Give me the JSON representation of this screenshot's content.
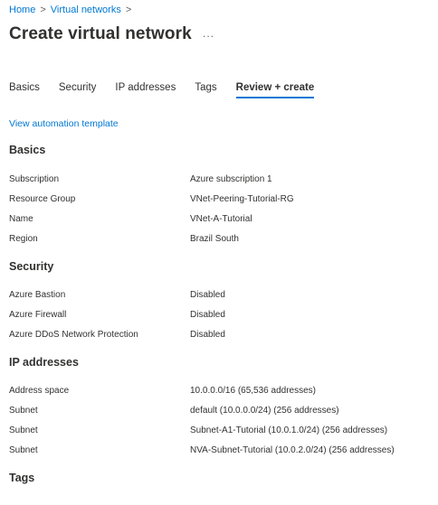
{
  "breadcrumb": {
    "items": [
      "Home",
      "Virtual networks"
    ],
    "separator": ">"
  },
  "page": {
    "title": "Create virtual network",
    "more_icon": "ellipsis-icon",
    "more_label": "..."
  },
  "tabs": [
    {
      "label": "Basics",
      "active": false
    },
    {
      "label": "Security",
      "active": false
    },
    {
      "label": "IP addresses",
      "active": false
    },
    {
      "label": "Tags",
      "active": false
    },
    {
      "label": "Review + create",
      "active": true
    }
  ],
  "automation_link": "View automation template",
  "sections": {
    "basics": {
      "heading": "Basics",
      "rows": [
        {
          "label": "Subscription",
          "value": "Azure subscription 1"
        },
        {
          "label": "Resource Group",
          "value": "VNet-Peering-Tutorial-RG"
        },
        {
          "label": "Name",
          "value": "VNet-A-Tutorial"
        },
        {
          "label": "Region",
          "value": "Brazil South"
        }
      ]
    },
    "security": {
      "heading": "Security",
      "rows": [
        {
          "label": "Azure Bastion",
          "value": "Disabled"
        },
        {
          "label": "Azure Firewall",
          "value": "Disabled"
        },
        {
          "label": "Azure DDoS Network Protection",
          "value": "Disabled"
        }
      ]
    },
    "ip_addresses": {
      "heading": "IP addresses",
      "rows": [
        {
          "label": "Address space",
          "value": "10.0.0.0/16 (65,536 addresses)"
        },
        {
          "label": "Subnet",
          "value": "default (10.0.0.0/24) (256 addresses)"
        },
        {
          "label": "Subnet",
          "value": "Subnet-A1-Tutorial (10.0.1.0/24) (256 addresses)"
        },
        {
          "label": "Subnet",
          "value": "NVA-Subnet-Tutorial (10.0.2.0/24) (256 addresses)"
        }
      ]
    },
    "tags": {
      "heading": "Tags"
    }
  },
  "colors": {
    "link": "#0078d4",
    "text": "#323130",
    "active_tab_underline": "#0078d4"
  }
}
